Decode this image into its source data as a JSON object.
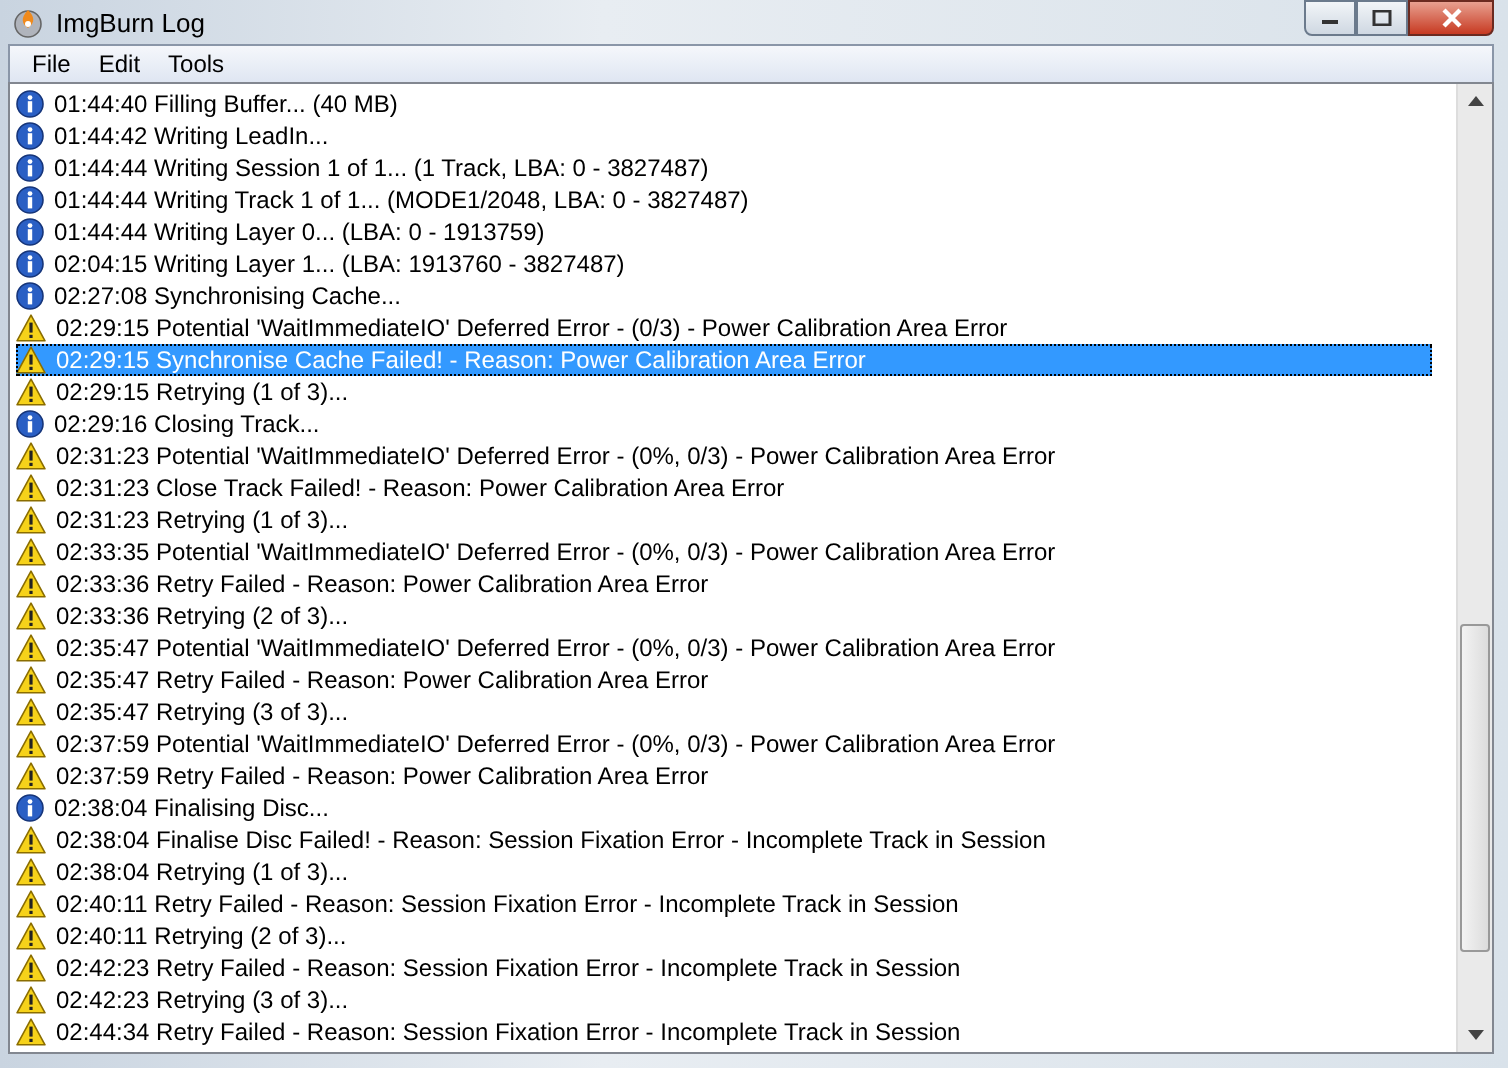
{
  "window": {
    "title": "ImgBurn Log"
  },
  "menu": [
    "File",
    "Edit",
    "Tools"
  ],
  "log": [
    {
      "kind": "info",
      "selected": false,
      "text": "01:44:40 Filling Buffer... (40 MB)"
    },
    {
      "kind": "info",
      "selected": false,
      "text": "01:44:42 Writing LeadIn..."
    },
    {
      "kind": "info",
      "selected": false,
      "text": "01:44:44 Writing Session 1 of 1... (1 Track, LBA: 0 - 3827487)"
    },
    {
      "kind": "info",
      "selected": false,
      "text": "01:44:44 Writing Track 1 of 1... (MODE1/2048, LBA: 0 - 3827487)"
    },
    {
      "kind": "info",
      "selected": false,
      "text": "01:44:44 Writing Layer 0... (LBA: 0 - 1913759)"
    },
    {
      "kind": "info",
      "selected": false,
      "text": "02:04:15 Writing Layer 1... (LBA: 1913760 - 3827487)"
    },
    {
      "kind": "info",
      "selected": false,
      "text": "02:27:08 Synchronising Cache..."
    },
    {
      "kind": "warning",
      "selected": false,
      "text": "02:29:15 Potential 'WaitImmediateIO' Deferred Error - (0/3) - Power Calibration Area Error"
    },
    {
      "kind": "warning",
      "selected": true,
      "text": "02:29:15 Synchronise Cache Failed! - Reason: Power Calibration Area Error"
    },
    {
      "kind": "warning",
      "selected": false,
      "text": "02:29:15 Retrying (1 of 3)..."
    },
    {
      "kind": "info",
      "selected": false,
      "text": "02:29:16 Closing Track..."
    },
    {
      "kind": "warning",
      "selected": false,
      "text": "02:31:23 Potential 'WaitImmediateIO' Deferred Error - (0%, 0/3) - Power Calibration Area Error"
    },
    {
      "kind": "warning",
      "selected": false,
      "text": "02:31:23 Close Track Failed! - Reason: Power Calibration Area Error"
    },
    {
      "kind": "warning",
      "selected": false,
      "text": "02:31:23 Retrying (1 of 3)..."
    },
    {
      "kind": "warning",
      "selected": false,
      "text": "02:33:35 Potential 'WaitImmediateIO' Deferred Error - (0%, 0/3) - Power Calibration Area Error"
    },
    {
      "kind": "warning",
      "selected": false,
      "text": "02:33:36 Retry Failed - Reason: Power Calibration Area Error"
    },
    {
      "kind": "warning",
      "selected": false,
      "text": "02:33:36 Retrying (2 of 3)..."
    },
    {
      "kind": "warning",
      "selected": false,
      "text": "02:35:47 Potential 'WaitImmediateIO' Deferred Error - (0%, 0/3) - Power Calibration Area Error"
    },
    {
      "kind": "warning",
      "selected": false,
      "text": "02:35:47 Retry Failed - Reason: Power Calibration Area Error"
    },
    {
      "kind": "warning",
      "selected": false,
      "text": "02:35:47 Retrying (3 of 3)..."
    },
    {
      "kind": "warning",
      "selected": false,
      "text": "02:37:59 Potential 'WaitImmediateIO' Deferred Error - (0%, 0/3) - Power Calibration Area Error"
    },
    {
      "kind": "warning",
      "selected": false,
      "text": "02:37:59 Retry Failed - Reason: Power Calibration Area Error"
    },
    {
      "kind": "info",
      "selected": false,
      "text": "02:38:04 Finalising Disc..."
    },
    {
      "kind": "warning",
      "selected": false,
      "text": "02:38:04 Finalise Disc Failed! - Reason: Session Fixation Error - Incomplete Track in Session"
    },
    {
      "kind": "warning",
      "selected": false,
      "text": "02:38:04 Retrying (1 of 3)..."
    },
    {
      "kind": "warning",
      "selected": false,
      "text": "02:40:11 Retry Failed - Reason: Session Fixation Error - Incomplete Track in Session"
    },
    {
      "kind": "warning",
      "selected": false,
      "text": "02:40:11 Retrying (2 of 3)..."
    },
    {
      "kind": "warning",
      "selected": false,
      "text": "02:42:23 Retry Failed - Reason: Session Fixation Error - Incomplete Track in Session"
    },
    {
      "kind": "warning",
      "selected": false,
      "text": "02:42:23 Retrying (3 of 3)..."
    },
    {
      "kind": "warning",
      "selected": false,
      "text": "02:44:34 Retry Failed - Reason: Session Fixation Error - Incomplete Track in Session"
    }
  ]
}
